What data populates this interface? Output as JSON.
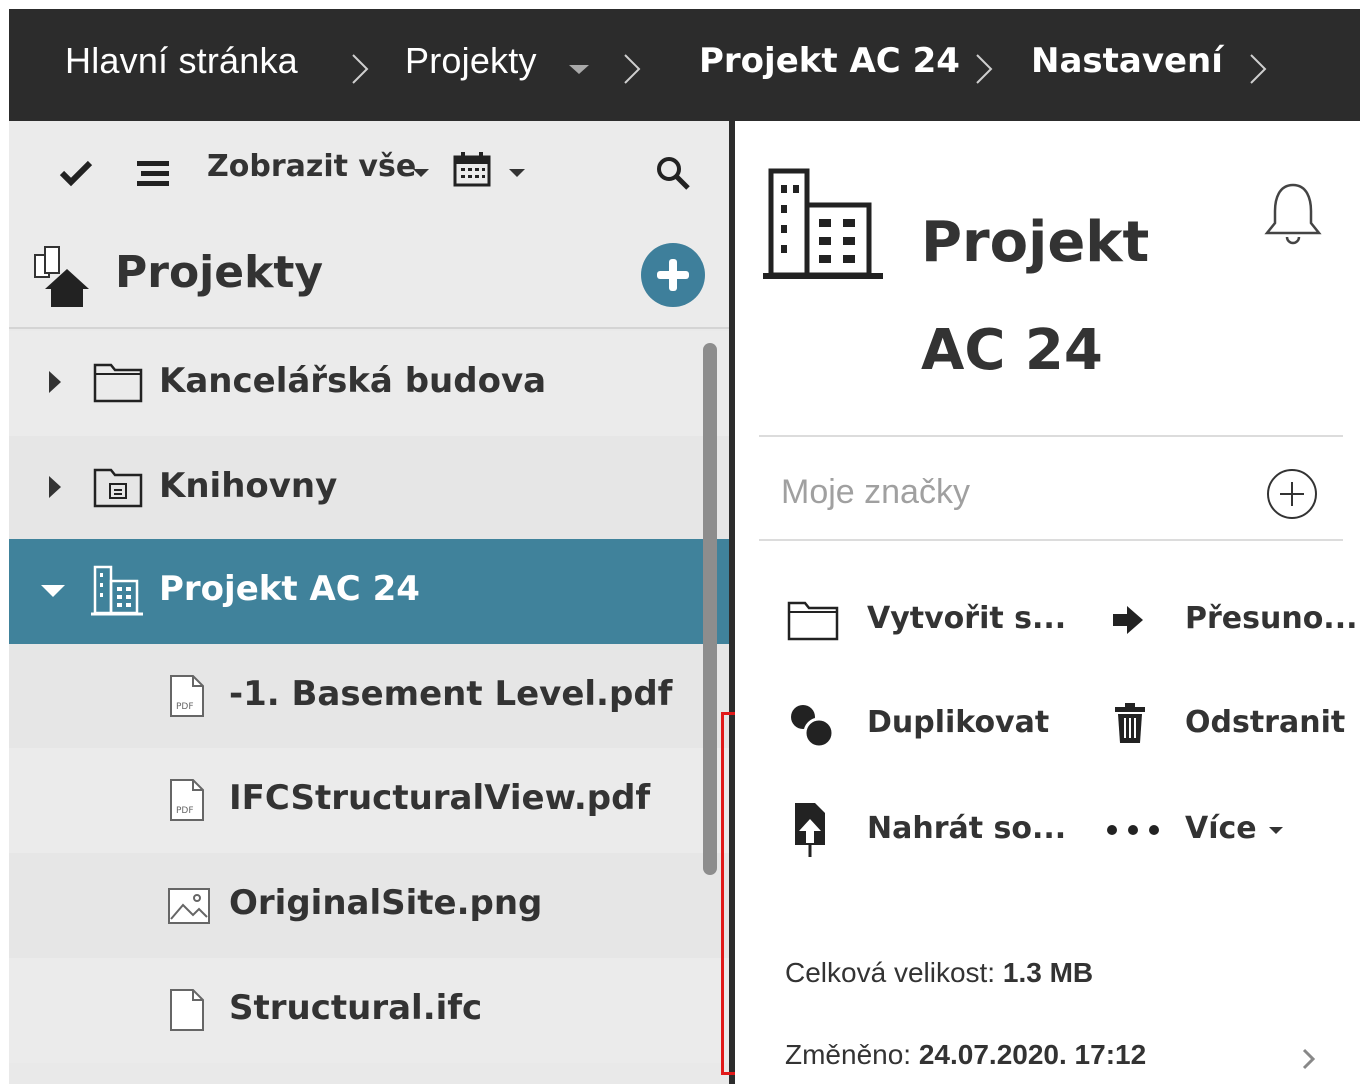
{
  "breadcrumb": {
    "items": [
      "Hlavní stránka",
      "Projekty",
      "Projekt AC 24",
      "Nastavení"
    ]
  },
  "toolbar": {
    "filter_label": "Zobrazit vše"
  },
  "tree": {
    "header": "Projekty",
    "rows": [
      {
        "label": "Kancelářská budova",
        "icon": "folder-icon"
      },
      {
        "label": "Knihovny",
        "icon": "library-folder-icon"
      },
      {
        "label": "Projekt AC 24",
        "icon": "building-icon",
        "selected": true
      },
      {
        "label": "-1. Basement Level.pdf",
        "icon": "pdf-file-icon"
      },
      {
        "label": "IFCStructuralView.pdf",
        "icon": "pdf-file-icon"
      },
      {
        "label": "OriginalSite.png",
        "icon": "image-file-icon"
      },
      {
        "label": "Structural.ifc",
        "icon": "file-icon"
      }
    ]
  },
  "detail": {
    "title": "Projekt AC 24",
    "tags_placeholder": "Moje značky",
    "actions": [
      {
        "label": "Vytvořit s...",
        "icon": "folder-icon"
      },
      {
        "label": "Přesuno...",
        "icon": "arrow-right-icon"
      },
      {
        "label": "Duplikovat",
        "icon": "duplicate-icon"
      },
      {
        "label": "Odstranit",
        "icon": "trash-icon"
      },
      {
        "label": "Nahrát so...",
        "icon": "upload-icon"
      },
      {
        "label": "Více",
        "icon": "more-icon"
      }
    ],
    "size_label": "Celková velikost:",
    "size_value": "1.3 MB",
    "modified_label": "Změněno:",
    "modified_value": "24.07.2020. 17:12"
  },
  "colors": {
    "topbar": "#2c2c2c",
    "accent": "#40829b",
    "add_button": "#3e7f9b",
    "highlight_box": "#e11a1a"
  }
}
